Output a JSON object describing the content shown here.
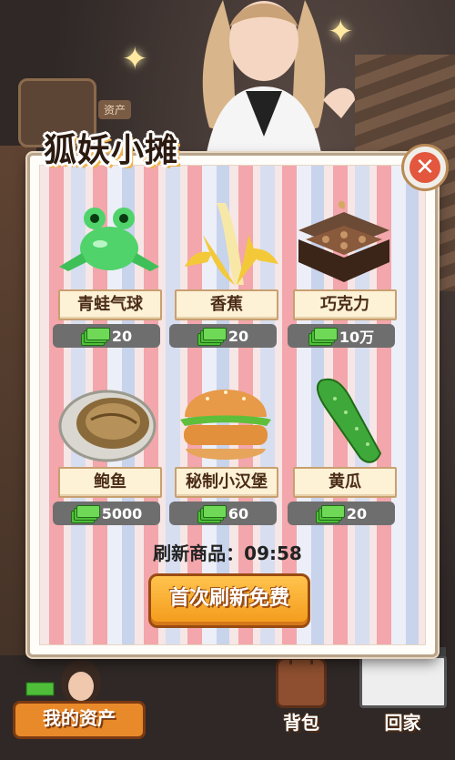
{
  "dialog": {
    "title": "狐妖小摊",
    "close_icon": "close-icon",
    "items": [
      {
        "name": "青蛙气球",
        "price": "20",
        "icon": "frog-balloon-icon"
      },
      {
        "name": "香蕉",
        "price": "20",
        "icon": "banana-icon"
      },
      {
        "name": "巧克力",
        "price": "10万",
        "icon": "chocolate-box-icon"
      },
      {
        "name": "鲍鱼",
        "price": "5000",
        "icon": "abalone-icon"
      },
      {
        "name": "秘制小汉堡",
        "price": "60",
        "icon": "burger-icon"
      },
      {
        "name": "黄瓜",
        "price": "20",
        "icon": "cucumber-icon"
      }
    ],
    "refresh_timer_text": "刷新商品：09:58",
    "refresh_button": "首次刷新免费"
  },
  "background": {
    "avatar_tag": "资产"
  },
  "bottom_bar": {
    "assets_label": "我的资产",
    "bag_label": "背包",
    "home_label": "回家"
  },
  "colors": {
    "accent_orange": "#f39a1a",
    "close_red": "#e2573d",
    "cash_green": "#4fbf3a",
    "price_bg": "#6e6e6e"
  }
}
